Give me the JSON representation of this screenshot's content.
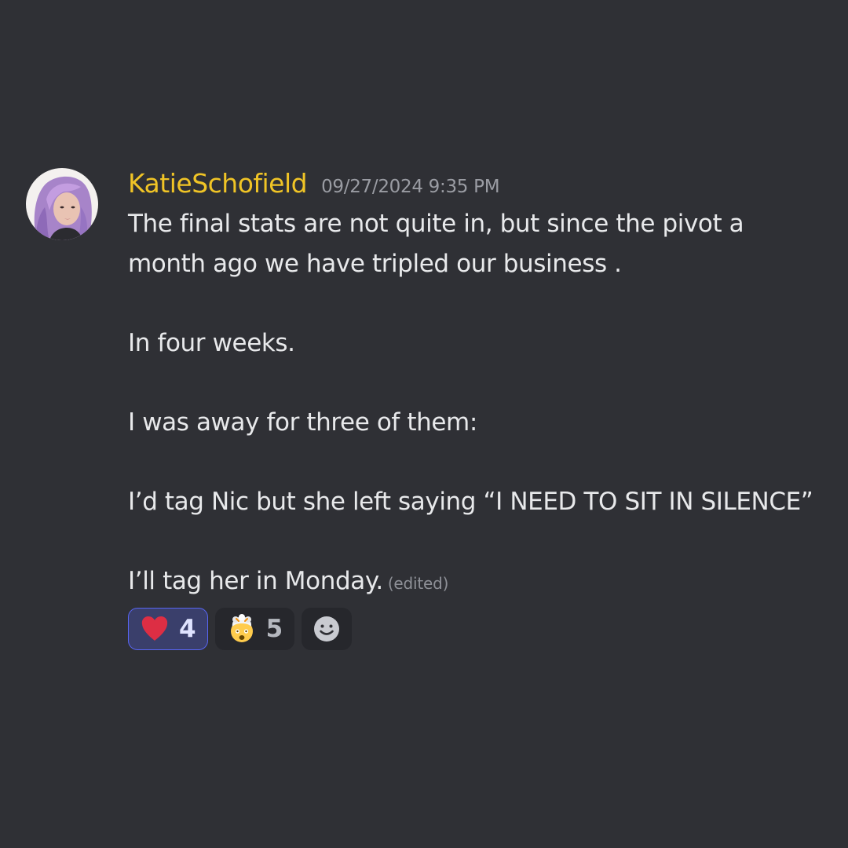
{
  "message": {
    "author": "KatieSchofield",
    "timestamp": "09/27/2024 9:35 PM",
    "paragraphs": [
      "The final stats are not quite in, but since the pivot a month ago we have tripled our business .",
      "In four weeks.",
      "I was away for three of them:",
      "I’d tag Nic but she left saying “I NEED TO SIT IN SILENCE”",
      "I’ll tag her in Monday."
    ],
    "edited_label": "(edited)"
  },
  "reactions": [
    {
      "emoji": "red-heart",
      "count": "4",
      "reacted": true
    },
    {
      "emoji": "exploding-head",
      "count": "5",
      "reacted": false
    }
  ],
  "add_reaction": {
    "icon": "smiley-add-reaction-icon"
  },
  "colors": {
    "background": "#2f3035",
    "username": "#f0c426",
    "text": "#e8e9eb",
    "muted": "#9a9ca3",
    "reaction_active_border": "#5865f2"
  }
}
